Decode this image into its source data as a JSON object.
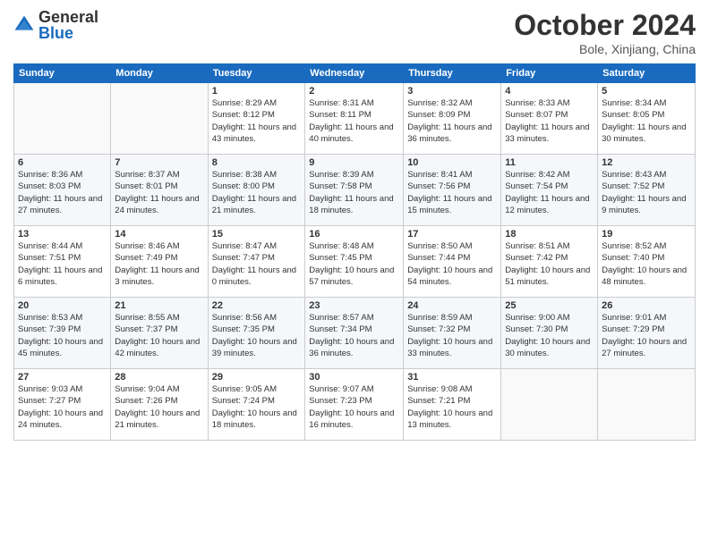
{
  "logo": {
    "general": "General",
    "blue": "Blue"
  },
  "title": {
    "month": "October 2024",
    "location": "Bole, Xinjiang, China"
  },
  "days_of_week": [
    "Sunday",
    "Monday",
    "Tuesday",
    "Wednesday",
    "Thursday",
    "Friday",
    "Saturday"
  ],
  "weeks": [
    [
      {
        "day": "",
        "info": ""
      },
      {
        "day": "",
        "info": ""
      },
      {
        "day": "1",
        "info": "Sunrise: 8:29 AM\nSunset: 8:12 PM\nDaylight: 11 hours and 43 minutes."
      },
      {
        "day": "2",
        "info": "Sunrise: 8:31 AM\nSunset: 8:11 PM\nDaylight: 11 hours and 40 minutes."
      },
      {
        "day": "3",
        "info": "Sunrise: 8:32 AM\nSunset: 8:09 PM\nDaylight: 11 hours and 36 minutes."
      },
      {
        "day": "4",
        "info": "Sunrise: 8:33 AM\nSunset: 8:07 PM\nDaylight: 11 hours and 33 minutes."
      },
      {
        "day": "5",
        "info": "Sunrise: 8:34 AM\nSunset: 8:05 PM\nDaylight: 11 hours and 30 minutes."
      }
    ],
    [
      {
        "day": "6",
        "info": "Sunrise: 8:36 AM\nSunset: 8:03 PM\nDaylight: 11 hours and 27 minutes."
      },
      {
        "day": "7",
        "info": "Sunrise: 8:37 AM\nSunset: 8:01 PM\nDaylight: 11 hours and 24 minutes."
      },
      {
        "day": "8",
        "info": "Sunrise: 8:38 AM\nSunset: 8:00 PM\nDaylight: 11 hours and 21 minutes."
      },
      {
        "day": "9",
        "info": "Sunrise: 8:39 AM\nSunset: 7:58 PM\nDaylight: 11 hours and 18 minutes."
      },
      {
        "day": "10",
        "info": "Sunrise: 8:41 AM\nSunset: 7:56 PM\nDaylight: 11 hours and 15 minutes."
      },
      {
        "day": "11",
        "info": "Sunrise: 8:42 AM\nSunset: 7:54 PM\nDaylight: 11 hours and 12 minutes."
      },
      {
        "day": "12",
        "info": "Sunrise: 8:43 AM\nSunset: 7:52 PM\nDaylight: 11 hours and 9 minutes."
      }
    ],
    [
      {
        "day": "13",
        "info": "Sunrise: 8:44 AM\nSunset: 7:51 PM\nDaylight: 11 hours and 6 minutes."
      },
      {
        "day": "14",
        "info": "Sunrise: 8:46 AM\nSunset: 7:49 PM\nDaylight: 11 hours and 3 minutes."
      },
      {
        "day": "15",
        "info": "Sunrise: 8:47 AM\nSunset: 7:47 PM\nDaylight: 11 hours and 0 minutes."
      },
      {
        "day": "16",
        "info": "Sunrise: 8:48 AM\nSunset: 7:45 PM\nDaylight: 10 hours and 57 minutes."
      },
      {
        "day": "17",
        "info": "Sunrise: 8:50 AM\nSunset: 7:44 PM\nDaylight: 10 hours and 54 minutes."
      },
      {
        "day": "18",
        "info": "Sunrise: 8:51 AM\nSunset: 7:42 PM\nDaylight: 10 hours and 51 minutes."
      },
      {
        "day": "19",
        "info": "Sunrise: 8:52 AM\nSunset: 7:40 PM\nDaylight: 10 hours and 48 minutes."
      }
    ],
    [
      {
        "day": "20",
        "info": "Sunrise: 8:53 AM\nSunset: 7:39 PM\nDaylight: 10 hours and 45 minutes."
      },
      {
        "day": "21",
        "info": "Sunrise: 8:55 AM\nSunset: 7:37 PM\nDaylight: 10 hours and 42 minutes."
      },
      {
        "day": "22",
        "info": "Sunrise: 8:56 AM\nSunset: 7:35 PM\nDaylight: 10 hours and 39 minutes."
      },
      {
        "day": "23",
        "info": "Sunrise: 8:57 AM\nSunset: 7:34 PM\nDaylight: 10 hours and 36 minutes."
      },
      {
        "day": "24",
        "info": "Sunrise: 8:59 AM\nSunset: 7:32 PM\nDaylight: 10 hours and 33 minutes."
      },
      {
        "day": "25",
        "info": "Sunrise: 9:00 AM\nSunset: 7:30 PM\nDaylight: 10 hours and 30 minutes."
      },
      {
        "day": "26",
        "info": "Sunrise: 9:01 AM\nSunset: 7:29 PM\nDaylight: 10 hours and 27 minutes."
      }
    ],
    [
      {
        "day": "27",
        "info": "Sunrise: 9:03 AM\nSunset: 7:27 PM\nDaylight: 10 hours and 24 minutes."
      },
      {
        "day": "28",
        "info": "Sunrise: 9:04 AM\nSunset: 7:26 PM\nDaylight: 10 hours and 21 minutes."
      },
      {
        "day": "29",
        "info": "Sunrise: 9:05 AM\nSunset: 7:24 PM\nDaylight: 10 hours and 18 minutes."
      },
      {
        "day": "30",
        "info": "Sunrise: 9:07 AM\nSunset: 7:23 PM\nDaylight: 10 hours and 16 minutes."
      },
      {
        "day": "31",
        "info": "Sunrise: 9:08 AM\nSunset: 7:21 PM\nDaylight: 10 hours and 13 minutes."
      },
      {
        "day": "",
        "info": ""
      },
      {
        "day": "",
        "info": ""
      }
    ]
  ]
}
